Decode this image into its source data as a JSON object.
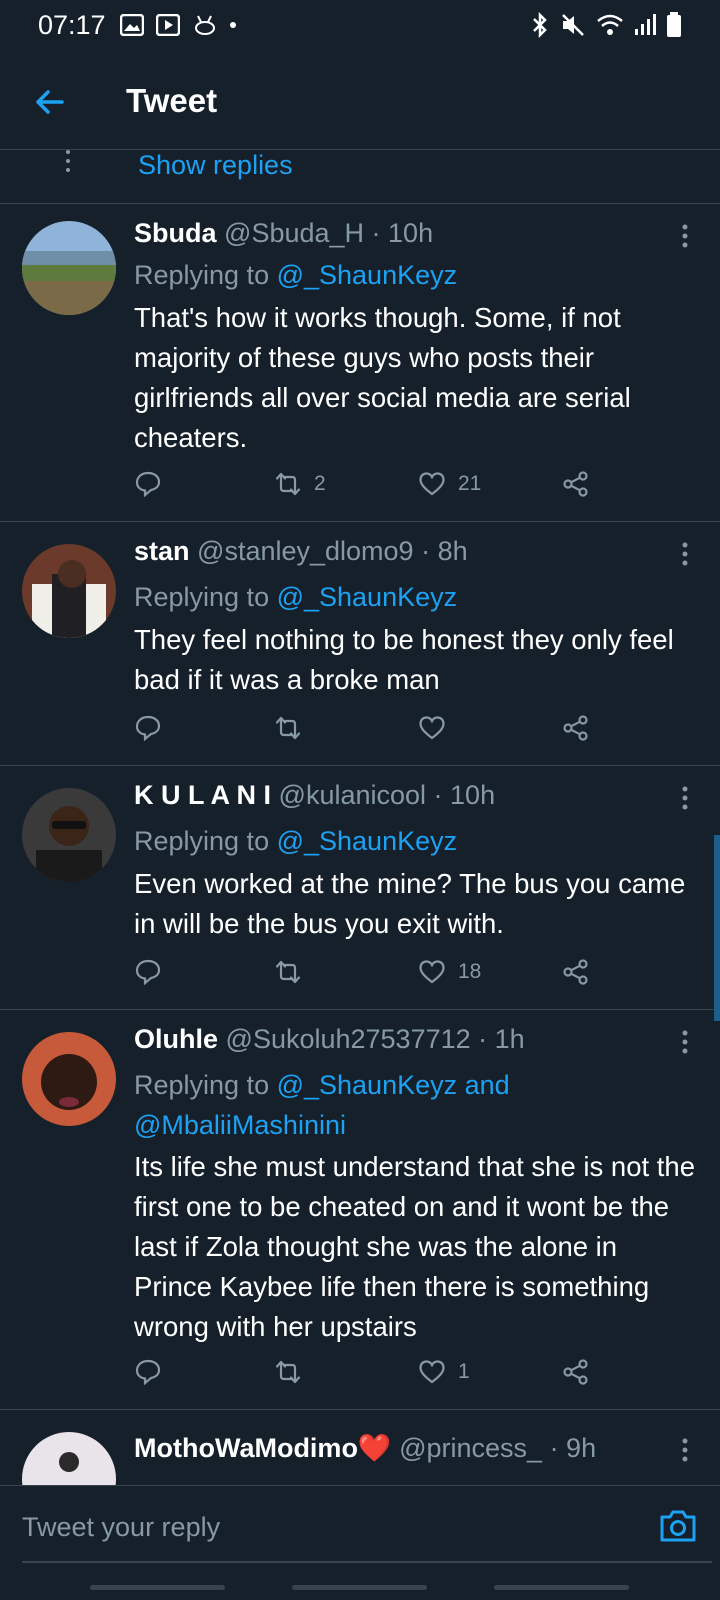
{
  "status_bar": {
    "time": "07:17",
    "left_icons": [
      "gallery-icon",
      "play-icon",
      "rabbit-icon",
      "dot"
    ],
    "right_icons": [
      "bluetooth-icon",
      "mute-icon",
      "wifi-icon",
      "signal-icon",
      "battery-icon"
    ]
  },
  "header": {
    "title": "Tweet"
  },
  "show_replies": {
    "label": "Show replies"
  },
  "tweets": [
    {
      "name": "Sbuda",
      "handle": "@Sbuda_H",
      "time": "· 10h",
      "replying_prefix": "Replying to ",
      "replying_to": "@_ShaunKeyz",
      "text": "That's how it works though. Some, if not majority of these guys who posts their girlfriends all over social media are serial cheaters.",
      "retweets": "2",
      "likes": "21"
    },
    {
      "name": "stan",
      "handle": "@stanley_dlomo9",
      "time": "· 8h",
      "replying_prefix": "Replying to ",
      "replying_to": "@_ShaunKeyz",
      "text": "They feel nothing to be honest they only feel bad if it was a broke man",
      "retweets": "",
      "likes": ""
    },
    {
      "name": "K U L A N I",
      "handle": "@kulanicool",
      "time": "· 10h",
      "replying_prefix": "Replying to ",
      "replying_to": "@_ShaunKeyz",
      "text": "Even worked at the mine? The bus you came in will be the bus you exit with.",
      "retweets": "",
      "likes": "18"
    },
    {
      "name": "Oluhle",
      "handle": "@Sukoluh27537712",
      "time": "· 1h",
      "replying_prefix": "Replying to ",
      "replying_to": "@_ShaunKeyz and @MbaliiMashinini",
      "text": "Its life she must understand that she is not the first one to be cheated on and it wont be the last if Zola thought she was the alone in Prince Kaybee life then there is something wrong with her upstairs",
      "retweets": "",
      "likes": "1"
    },
    {
      "name": "MothoWaModimo❤️",
      "handle": "@princess_",
      "time": "· 9h",
      "replying_prefix": "",
      "replying_to": "",
      "text": "",
      "retweets": "",
      "likes": ""
    }
  ],
  "reply_bar": {
    "placeholder": "Tweet your reply"
  },
  "colors": {
    "background": "#15202b",
    "accent": "#1da1f2",
    "secondary_text": "#8899a6",
    "divider": "#38444d"
  }
}
